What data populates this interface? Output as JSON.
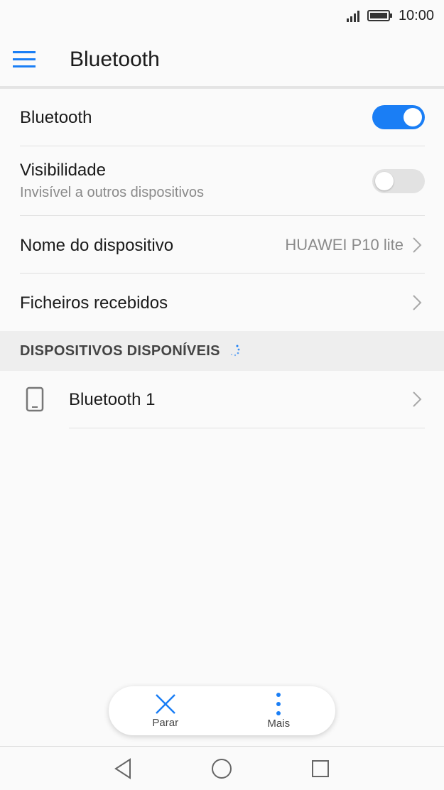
{
  "status_bar": {
    "time": "10:00"
  },
  "app_bar": {
    "title": "Bluetooth"
  },
  "settings": {
    "bluetooth": {
      "label": "Bluetooth",
      "enabled": true
    },
    "visibility": {
      "label": "Visibilidade",
      "subtitle": "Invisível a outros dispositivos",
      "enabled": false
    },
    "device_name": {
      "label": "Nome do dispositivo",
      "value": "HUAWEI P10 lite"
    },
    "received_files": {
      "label": "Ficheiros recebidos"
    }
  },
  "available_devices": {
    "header": "DISPOSITIVOS DISPONÍVEIS",
    "items": [
      {
        "name": "Bluetooth 1",
        "icon": "phone-icon"
      }
    ]
  },
  "bottom_actions": {
    "stop_label": "Parar",
    "more_label": "Mais"
  },
  "colors": {
    "accent": "#1a7ef5",
    "toggle_off": "#e2e2e2"
  }
}
